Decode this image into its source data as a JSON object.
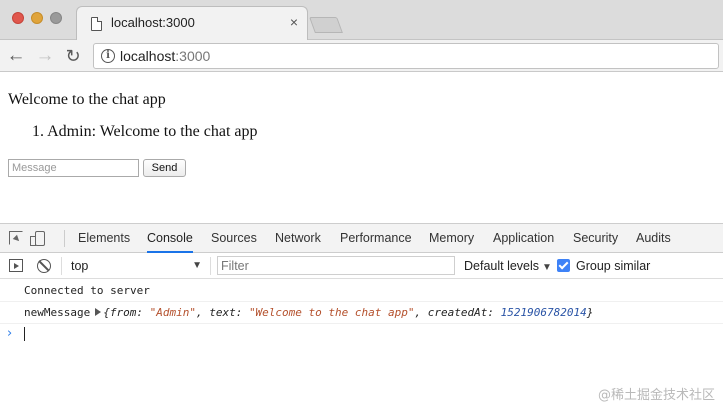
{
  "browser": {
    "tab_title": "localhost:3000",
    "tab_close": "×",
    "url_host": "localhost",
    "url_port": ":3000"
  },
  "page": {
    "heading": "Welcome to the chat app",
    "messages": [
      {
        "number": "1.",
        "text": "Admin: Welcome to the chat app"
      }
    ],
    "input_placeholder": "Message",
    "send_label": "Send"
  },
  "devtools": {
    "tabs": [
      "Elements",
      "Console",
      "Sources",
      "Network",
      "Performance",
      "Memory",
      "Application",
      "Security",
      "Audits"
    ],
    "active_tab": "Console",
    "context": "top",
    "filter_placeholder": "Filter",
    "levels_label": "Default levels",
    "group_similar_label": "Group similar",
    "group_similar_checked": true,
    "console": {
      "line1": "Connected to server",
      "line2_label": "newMessage",
      "line2_obj": {
        "open": "{from: ",
        "from_val": "\"Admin\"",
        "text_key": ", text: ",
        "text_val": "\"Welcome to the chat app\"",
        "created_key": ", createdAt: ",
        "created_val": "1521906782014",
        "close": "}"
      }
    }
  },
  "watermark": "@稀土掘金技术社区",
  "colors": {
    "active_tab_underline": "#1a73e8",
    "checkbox": "#3e82f7",
    "string": "#b4502c",
    "number": "#2a54a6",
    "prompt": "#2c7ce8"
  }
}
